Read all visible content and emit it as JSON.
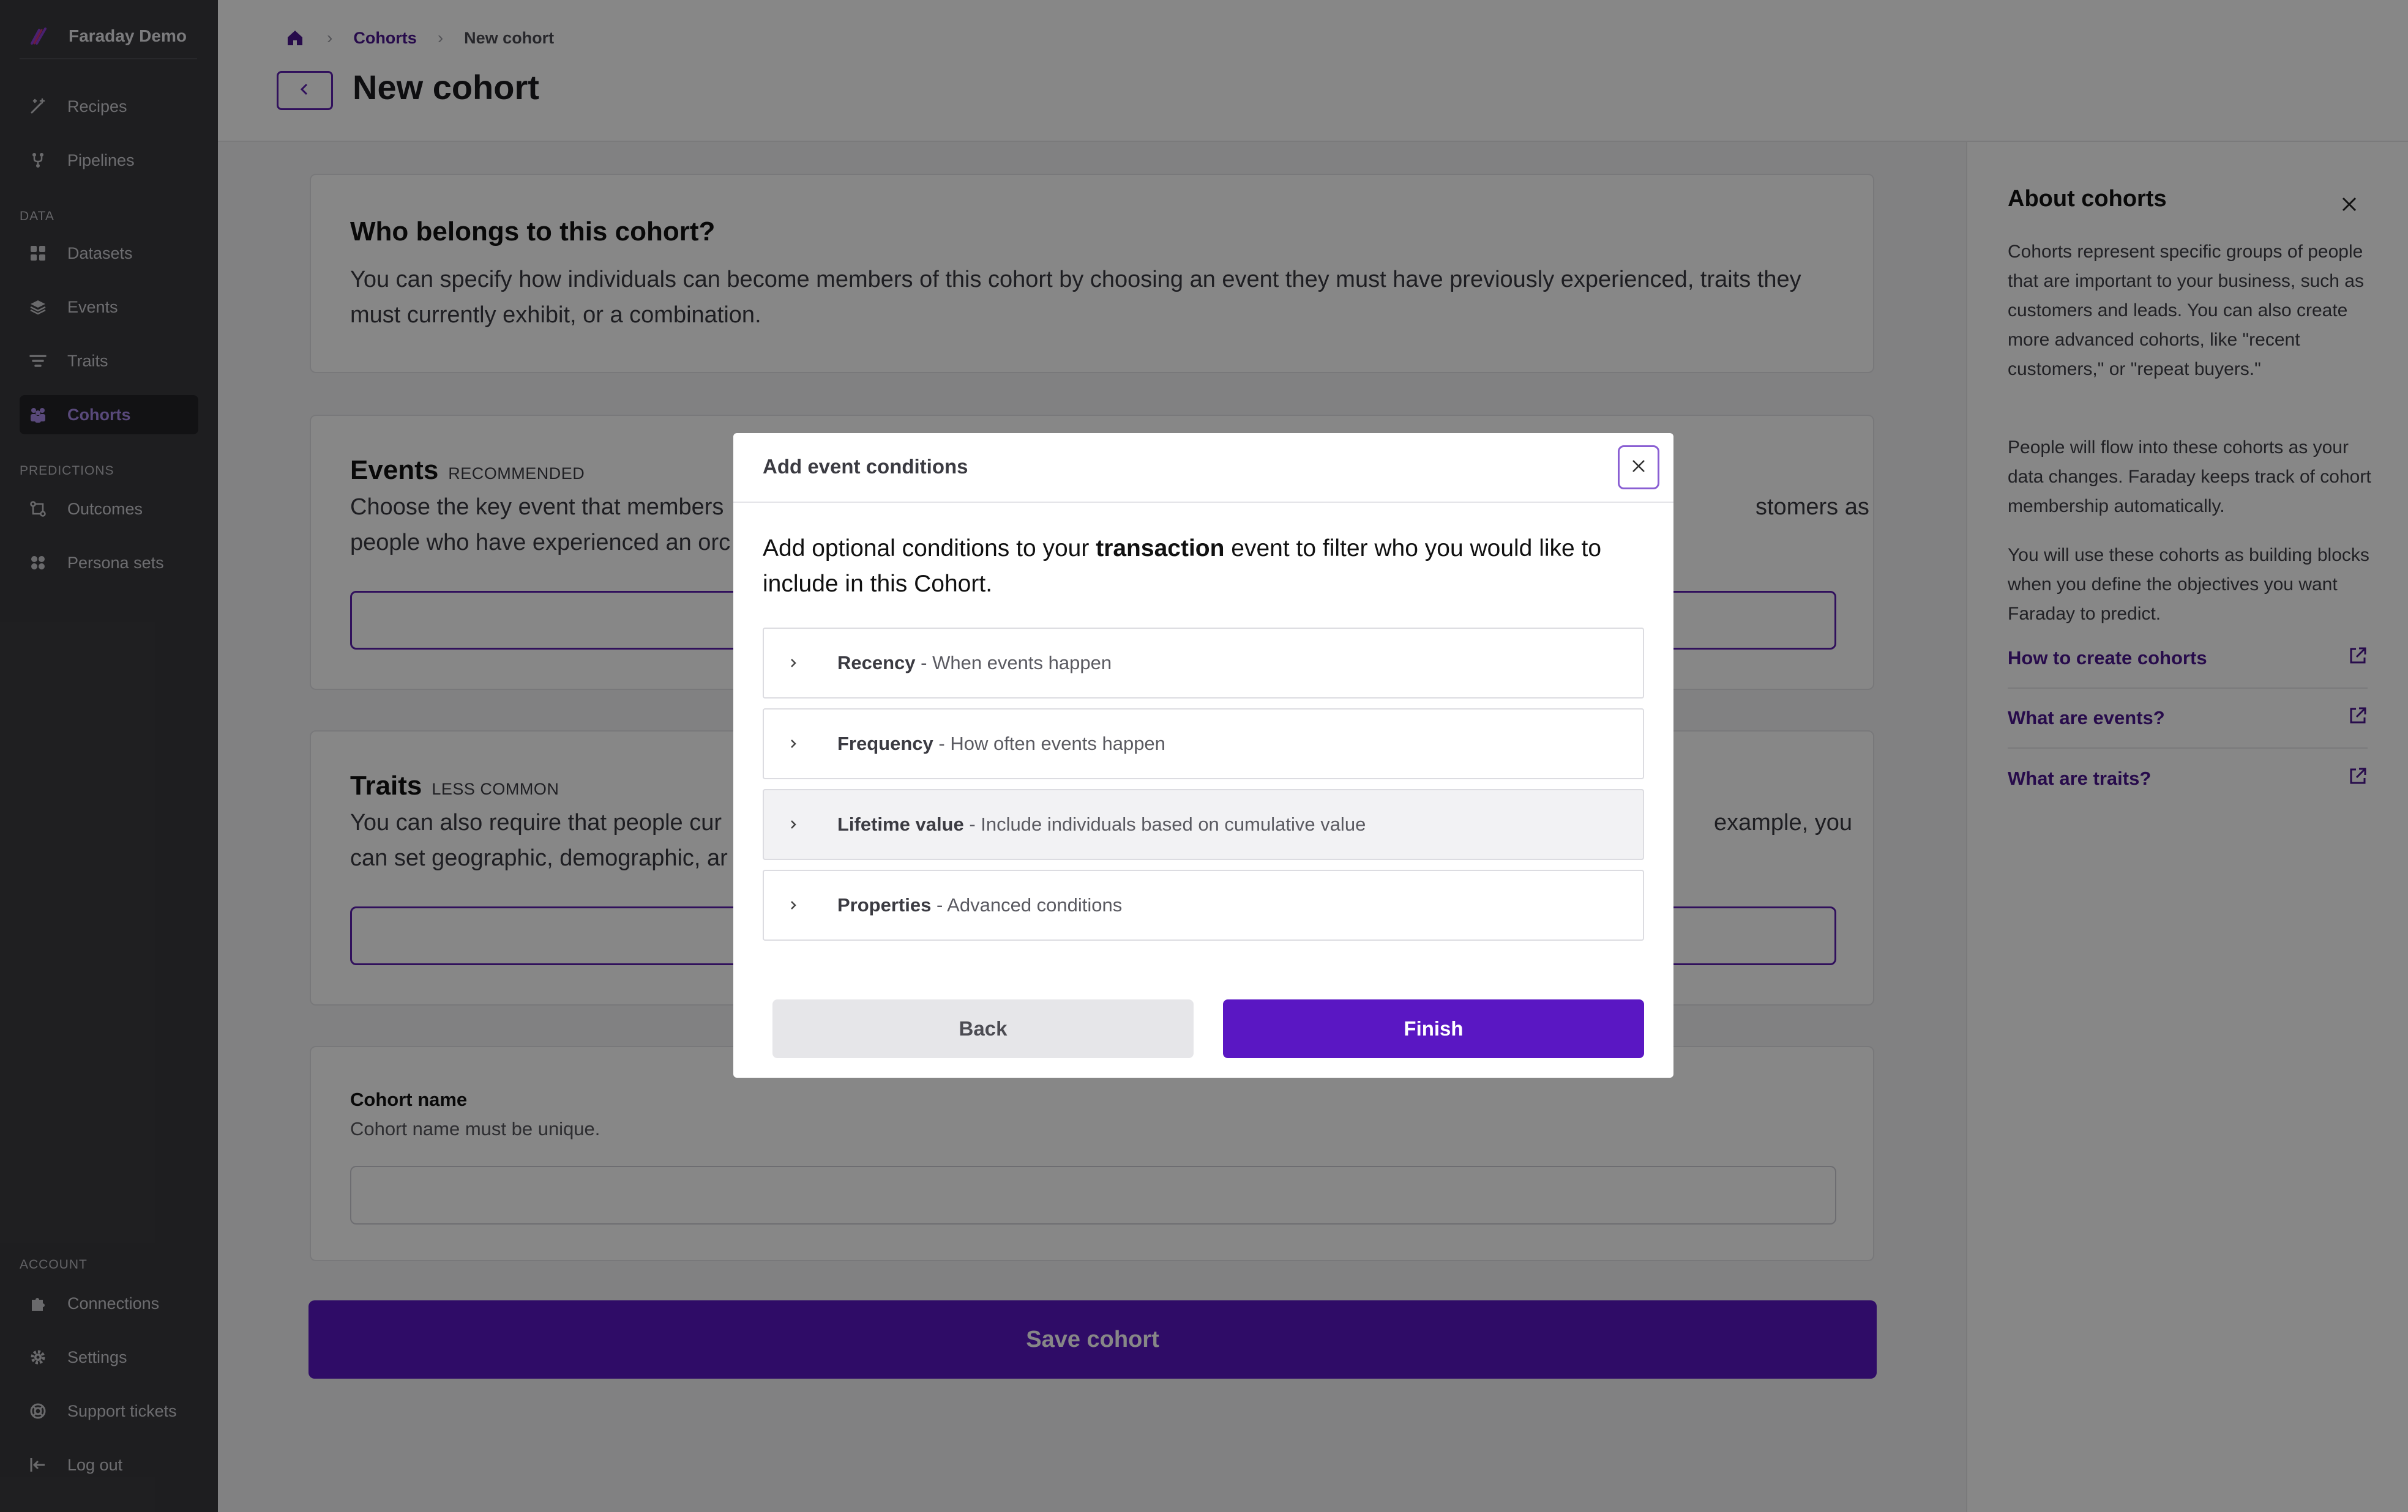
{
  "sidebar": {
    "brand": "Faraday Demo",
    "items_top": [
      {
        "label": "Recipes",
        "icon": "magic-wand-icon"
      },
      {
        "label": "Pipelines",
        "icon": "pipeline-icon"
      }
    ],
    "section_data": "DATA",
    "items_data": [
      {
        "label": "Datasets",
        "icon": "grid-icon"
      },
      {
        "label": "Events",
        "icon": "layers-icon"
      },
      {
        "label": "Traits",
        "icon": "filter-icon"
      },
      {
        "label": "Cohorts",
        "icon": "people-icon",
        "active": true
      }
    ],
    "section_predictions": "PREDICTIONS",
    "items_predictions": [
      {
        "label": "Outcomes",
        "icon": "outcomes-icon"
      },
      {
        "label": "Persona sets",
        "icon": "persona-icon"
      }
    ],
    "section_account": "ACCOUNT",
    "items_account": [
      {
        "label": "Connections",
        "icon": "puzzle-icon"
      },
      {
        "label": "Settings",
        "icon": "gear-icon"
      },
      {
        "label": "Support tickets",
        "icon": "lifebuoy-icon"
      },
      {
        "label": "Log out",
        "icon": "logout-icon"
      }
    ]
  },
  "header": {
    "breadcrumb": {
      "parent": "Cohorts",
      "current": "New cohort"
    },
    "title": "New cohort"
  },
  "main": {
    "who": {
      "title": "Who belongs to this cohort?",
      "text": "You can specify how individuals can become members of this cohort by choosing an event they must have previously experienced, traits they must currently exhibit, or a combination."
    },
    "events": {
      "title": "Events",
      "tag": "RECOMMENDED",
      "text_left": "Choose the key event that members",
      "text_right": "stomers as",
      "text_line2": "people who have experienced an orc"
    },
    "traits": {
      "title": "Traits",
      "tag": "LESS COMMON",
      "text_left": "You can also require that people cur",
      "text_right": "example, you",
      "text_line2": "can set geographic, demographic, ar"
    },
    "cohort_name": {
      "label": "Cohort name",
      "hint": "Cohort name must be unique.",
      "value": ""
    },
    "save_label": "Save cohort"
  },
  "about": {
    "title": "About cohorts",
    "paragraphs": [
      "Cohorts represent specific groups of people that are important to your business, such as customers and leads. You can also create more advanced cohorts, like \"recent customers,\" or \"repeat buyers.\"",
      "People will flow into these cohorts as your data changes. Faraday keeps track of cohort membership automatically.",
      "You will use these cohorts as building blocks when you define the objectives you want Faraday to predict."
    ],
    "links": [
      "How to create cohorts",
      "What are events?",
      "What are traits?"
    ]
  },
  "modal": {
    "title": "Add event conditions",
    "intro_before": "Add optional conditions to your ",
    "intro_bold": "transaction",
    "intro_after": " event to filter who you would like to include in this Cohort.",
    "sections": [
      {
        "name": "Recency",
        "desc": " - When events happen"
      },
      {
        "name": "Frequency",
        "desc": " - How often events happen"
      },
      {
        "name": "Lifetime value",
        "desc": " - Include individuals based on cumulative value"
      },
      {
        "name": "Properties",
        "desc": " - Advanced conditions"
      }
    ],
    "back_label": "Back",
    "finish_label": "Finish"
  },
  "colors": {
    "accent": "#5a17c3",
    "link": "#4a168f",
    "sidebar_bg": "#3a3a3e",
    "overlay": "rgba(0,0,0,0.47)"
  }
}
